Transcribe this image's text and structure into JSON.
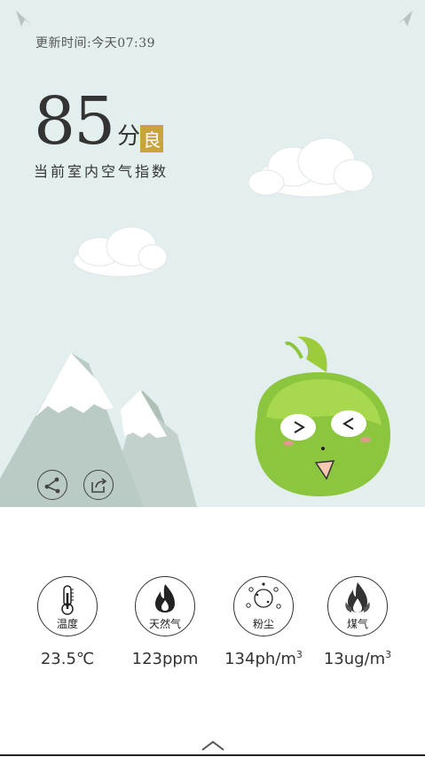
{
  "header": {
    "update_time": "更新时间:今天07:39"
  },
  "air": {
    "score": "85",
    "unit": "分",
    "level": "良",
    "caption": "当前室内空气指数"
  },
  "icons": {
    "top_left": "paper-plane-icon",
    "top_right": "paper-plane-icon",
    "share": "share-icon",
    "export": "export-icon",
    "expand": "chevron-up-icon"
  },
  "metrics": [
    {
      "icon": "thermometer-icon",
      "label": "温度",
      "value": "23.5℃",
      "sup": ""
    },
    {
      "icon": "flame-icon",
      "label": "天然气",
      "value": "123ppm",
      "sup": ""
    },
    {
      "icon": "dust-icon",
      "label": "粉尘",
      "value": "134ph/m",
      "sup": "3"
    },
    {
      "icon": "coal-gas-icon",
      "label": "煤气",
      "value": "13ug/m",
      "sup": "3"
    }
  ],
  "colors": {
    "sky": "#e3eeee",
    "level_badge": "#c9a43a",
    "mascot": "#8cc63f",
    "mountain": "#b9cbc4"
  }
}
